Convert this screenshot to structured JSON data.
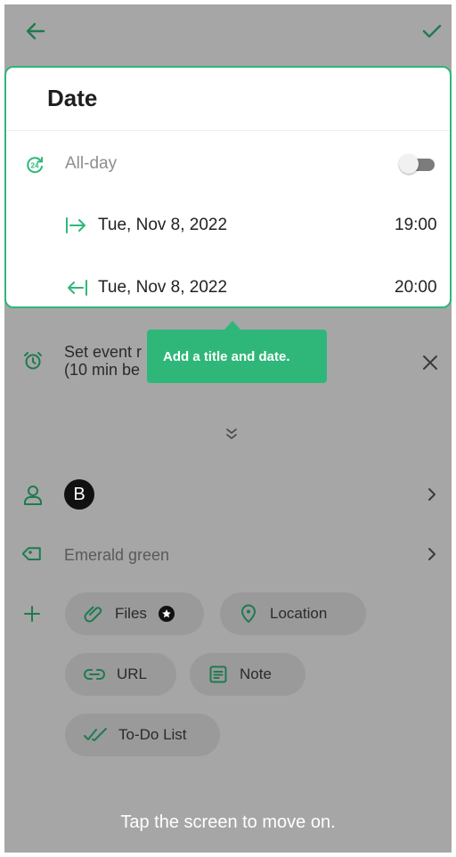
{
  "card": {
    "title": "Date",
    "all_day_label": "All-day",
    "start": {
      "date": "Tue, Nov 8, 2022",
      "time": "19:00"
    },
    "end": {
      "date": "Tue, Nov 8, 2022",
      "time": "20:00"
    }
  },
  "tooltip": {
    "text": "Add a title and date."
  },
  "reminder": {
    "line1": "Set event r",
    "line2": "(10 min be"
  },
  "participant": {
    "avatar_letter": "B"
  },
  "color": {
    "label": "Emerald green"
  },
  "chips": {
    "files": "Files",
    "location": "Location",
    "url": "URL",
    "note": "Note",
    "todo": "To-Do List"
  },
  "footer": {
    "hint": "Tap the screen to move on."
  },
  "colors": {
    "accent": "#2fb779",
    "overlay": "#a6a6a6",
    "icon_dim": "#1f7a50"
  },
  "icons": [
    "back-arrow-icon",
    "check-icon",
    "all-day-24-icon",
    "start-arrow-icon",
    "end-arrow-icon",
    "alarm-icon",
    "close-icon",
    "double-chevron-down-icon",
    "person-icon",
    "tag-icon",
    "chevron-right-icon",
    "plus-icon",
    "paperclip-icon",
    "star-badge-icon",
    "location-pin-icon",
    "link-icon",
    "note-icon",
    "todo-checks-icon"
  ]
}
